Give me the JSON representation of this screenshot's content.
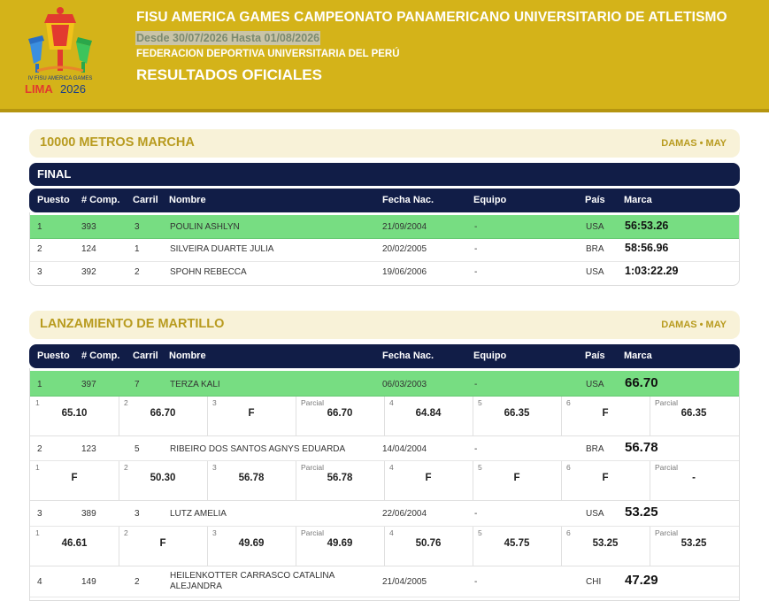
{
  "header": {
    "title": "FISU AMERICA GAMES CAMPEONATO PANAMERICANO UNIVERSITARIO DE ATLETISMO",
    "dates": "Desde 30/07/2026 Hasta 01/08/2026",
    "federation": "FEDERACION DEPORTIVA UNIVERSITARIA DEL PERÚ",
    "results": "RESULTADOS OFICIALES",
    "logo_small": "IV FISU AMERICA GAMES",
    "logo_lima": "LIMA",
    "logo_year": "2026"
  },
  "columns": {
    "place": "Puesto",
    "comp": "# Comp.",
    "lane": "Carril",
    "name": "Nombre",
    "dob": "Fecha Nac.",
    "team": "Equipo",
    "country": "País",
    "mark": "Marca"
  },
  "events": [
    {
      "name": "10000 METROS MARCHA",
      "category": "DAMAS • MAY",
      "round": "FINAL",
      "rows": [
        {
          "place": "1",
          "comp": "393",
          "lane": "3",
          "name": "POULIN ASHLYN",
          "dob": "21/09/2004",
          "team": "-",
          "country": "USA",
          "mark": "56:53.26"
        },
        {
          "place": "2",
          "comp": "124",
          "lane": "1",
          "name": "SILVEIRA DUARTE JULIA",
          "dob": "20/02/2005",
          "team": "-",
          "country": "BRA",
          "mark": "58:56.96"
        },
        {
          "place": "3",
          "comp": "392",
          "lane": "2",
          "name": "SPOHN REBECCA",
          "dob": "19/06/2006",
          "team": "-",
          "country": "USA",
          "mark": "1:03:22.29"
        }
      ]
    },
    {
      "name": "LANZAMIENTO DE MARTILLO",
      "category": "DAMAS • MAY",
      "attempt_labels": [
        "1",
        "2",
        "3",
        "Parcial",
        "4",
        "5",
        "6",
        "Parcial"
      ],
      "rows": [
        {
          "place": "1",
          "comp": "397",
          "lane": "7",
          "name": "TERZA KALI",
          "dob": "06/03/2003",
          "team": "-",
          "country": "USA",
          "mark": "66.70",
          "attempts": [
            "65.10",
            "66.70",
            "F",
            "66.70",
            "64.84",
            "66.35",
            "F",
            "66.35"
          ]
        },
        {
          "place": "2",
          "comp": "123",
          "lane": "5",
          "name": "RIBEIRO DOS SANTOS AGNYS EDUARDA",
          "dob": "14/04/2004",
          "team": "-",
          "country": "BRA",
          "mark": "56.78",
          "attempts": [
            "F",
            "50.30",
            "56.78",
            "56.78",
            "F",
            "F",
            "F",
            "-"
          ]
        },
        {
          "place": "3",
          "comp": "389",
          "lane": "3",
          "name": "LUTZ AMELIA",
          "dob": "22/06/2004",
          "team": "-",
          "country": "USA",
          "mark": "53.25",
          "attempts": [
            "46.61",
            "F",
            "49.69",
            "49.69",
            "50.76",
            "45.75",
            "53.25",
            "53.25"
          ]
        },
        {
          "place": "4",
          "comp": "149",
          "lane": "2",
          "name": "HEILENKOTTER CARRASCO CATALINA ALEJANDRA",
          "dob": "21/04/2005",
          "team": "-",
          "country": "CHI",
          "mark": "47.29",
          "attempts": [
            "",
            "",
            "",
            "",
            "",
            "",
            "",
            ""
          ]
        }
      ]
    }
  ]
}
